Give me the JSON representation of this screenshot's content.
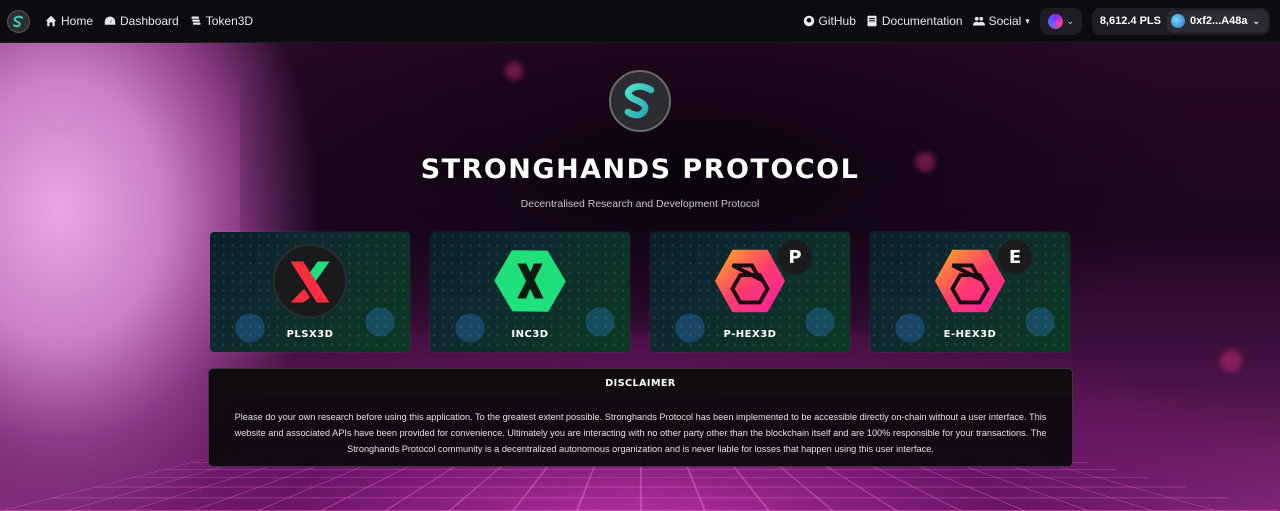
{
  "nav": {
    "home": "Home",
    "dashboard": "Dashboard",
    "token3d": "Token3D",
    "github": "GitHub",
    "documentation": "Documentation",
    "social": "Social",
    "balance": "8,612.4 PLS",
    "address": "0xf2...A48a"
  },
  "hero": {
    "title": "STRONGHANDS PROTOCOL",
    "subtitle": "Decentralised Research and Development Protocol"
  },
  "cards": [
    {
      "label": "PLSX3D",
      "icon": "plsx-icon"
    },
    {
      "label": "INC3D",
      "icon": "inc-icon"
    },
    {
      "label": "P-HEX3D",
      "icon": "hex-icon",
      "badge": "P"
    },
    {
      "label": "E-HEX3D",
      "icon": "hex-icon",
      "badge": "E"
    }
  ],
  "disclaimer": {
    "title": "DISCLAIMER",
    "body": "Please do your own research before using this application. To the greatest extent possible. Stronghands Protocol has been implemented to be accessible directly on-chain without a user interface. This website and associated APIs have been provided for convenience. Ultimately you are interacting with no other party other than the blockchain itself and are 100% responsible for your transactions. The Stronghands Protocol community is a decentralized autonomous organization and is never liable for losses that happen using this user interface."
  },
  "colors": {
    "accent_teal": "#3fd1b8",
    "inc_green": "#1fe07a",
    "hex_pink": "#ff2e8a",
    "hex_orange": "#ffb21e"
  }
}
